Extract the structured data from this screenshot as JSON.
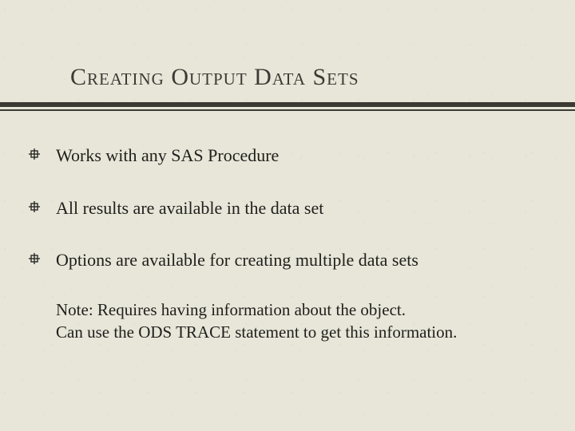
{
  "title": "Creating Output Data Sets",
  "bullets": [
    "Works with any SAS Procedure",
    "All results are available in the data set",
    "Options are available for creating multiple data sets"
  ],
  "note_line1": "Note: Requires having information about the object.",
  "note_line2": "Can use the ODS TRACE statement to get this information."
}
